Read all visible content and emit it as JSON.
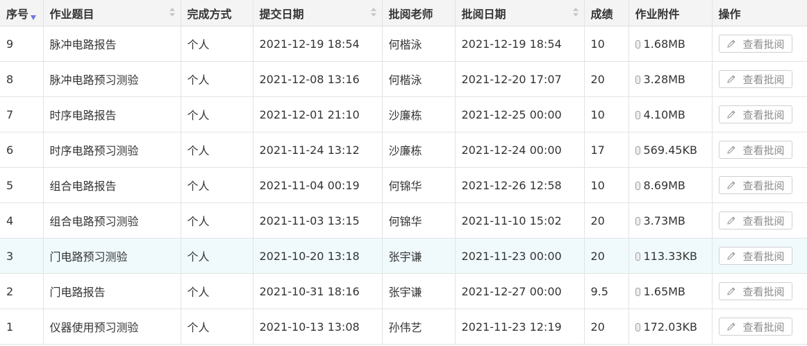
{
  "columns": {
    "index": "序号",
    "title": "作业题目",
    "mode": "完成方式",
    "submit_date": "提交日期",
    "teacher": "批阅老师",
    "review_date": "批阅日期",
    "score": "成绩",
    "attachment": "作业附件",
    "action": "操作"
  },
  "action_label": "查看批阅",
  "accent_color": "#6c76d8",
  "highlight_row_color": "#f0fafd",
  "rows": [
    {
      "index": "9",
      "title": "脉冲电路报告",
      "mode": "个人",
      "submit_date": "2021-12-19 18:54",
      "teacher": "何楷泳",
      "review_date": "2021-12-19 18:54",
      "score": "10",
      "attachment": "1.68MB"
    },
    {
      "index": "8",
      "title": "脉冲电路预习测验",
      "mode": "个人",
      "submit_date": "2021-12-08 13:16",
      "teacher": "何楷泳",
      "review_date": "2021-12-20 17:07",
      "score": "20",
      "attachment": "3.28MB"
    },
    {
      "index": "7",
      "title": "时序电路报告",
      "mode": "个人",
      "submit_date": "2021-12-01 21:10",
      "teacher": "沙廉栋",
      "review_date": "2021-12-25 00:00",
      "score": "10",
      "attachment": "4.10MB"
    },
    {
      "index": "6",
      "title": "时序电路预习测验",
      "mode": "个人",
      "submit_date": "2021-11-24 13:12",
      "teacher": "沙廉栋",
      "review_date": "2021-12-24 00:00",
      "score": "17",
      "attachment": "569.45KB"
    },
    {
      "index": "5",
      "title": "组合电路报告",
      "mode": "个人",
      "submit_date": "2021-11-04 00:19",
      "teacher": "何锦华",
      "review_date": "2021-12-26 12:58",
      "score": "10",
      "attachment": "8.69MB"
    },
    {
      "index": "4",
      "title": "组合电路预习测验",
      "mode": "个人",
      "submit_date": "2021-11-03 13:15",
      "teacher": "何锦华",
      "review_date": "2021-11-10 15:02",
      "score": "20",
      "attachment": "3.73MB"
    },
    {
      "index": "3",
      "title": "门电路预习测验",
      "mode": "个人",
      "submit_date": "2021-10-20 13:18",
      "teacher": "张宇谦",
      "review_date": "2021-11-23 00:00",
      "score": "20",
      "attachment": "113.33KB"
    },
    {
      "index": "2",
      "title": "门电路报告",
      "mode": "个人",
      "submit_date": "2021-10-31 18:16",
      "teacher": "张宇谦",
      "review_date": "2021-12-27 00:00",
      "score": "9.5",
      "attachment": "1.65MB"
    },
    {
      "index": "1",
      "title": "仪器使用预习测验",
      "mode": "个人",
      "submit_date": "2021-10-13 13:08",
      "teacher": "孙伟艺",
      "review_date": "2021-11-23 12:19",
      "score": "20",
      "attachment": "172.03KB"
    }
  ]
}
